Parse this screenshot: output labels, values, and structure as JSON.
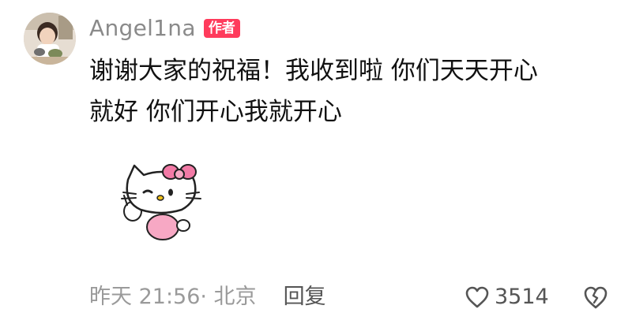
{
  "comment": {
    "username": "Angel1na",
    "author_badge": "作者",
    "text": "谢谢大家的祝福！我收到啦 你们天天开心\n就好 你们开心我就开心",
    "sticker": "hello-kitty-wink-sticker",
    "timestamp": "昨天 21:56· 北京",
    "reply_label": "回复",
    "like_count": "3514"
  },
  "icons": {
    "like": "heart-outline-icon",
    "dislike": "broken-heart-outline-icon"
  },
  "colors": {
    "badge": "#ff3b5c",
    "username": "#8a8a8a",
    "meta": "#9a9a9a"
  }
}
